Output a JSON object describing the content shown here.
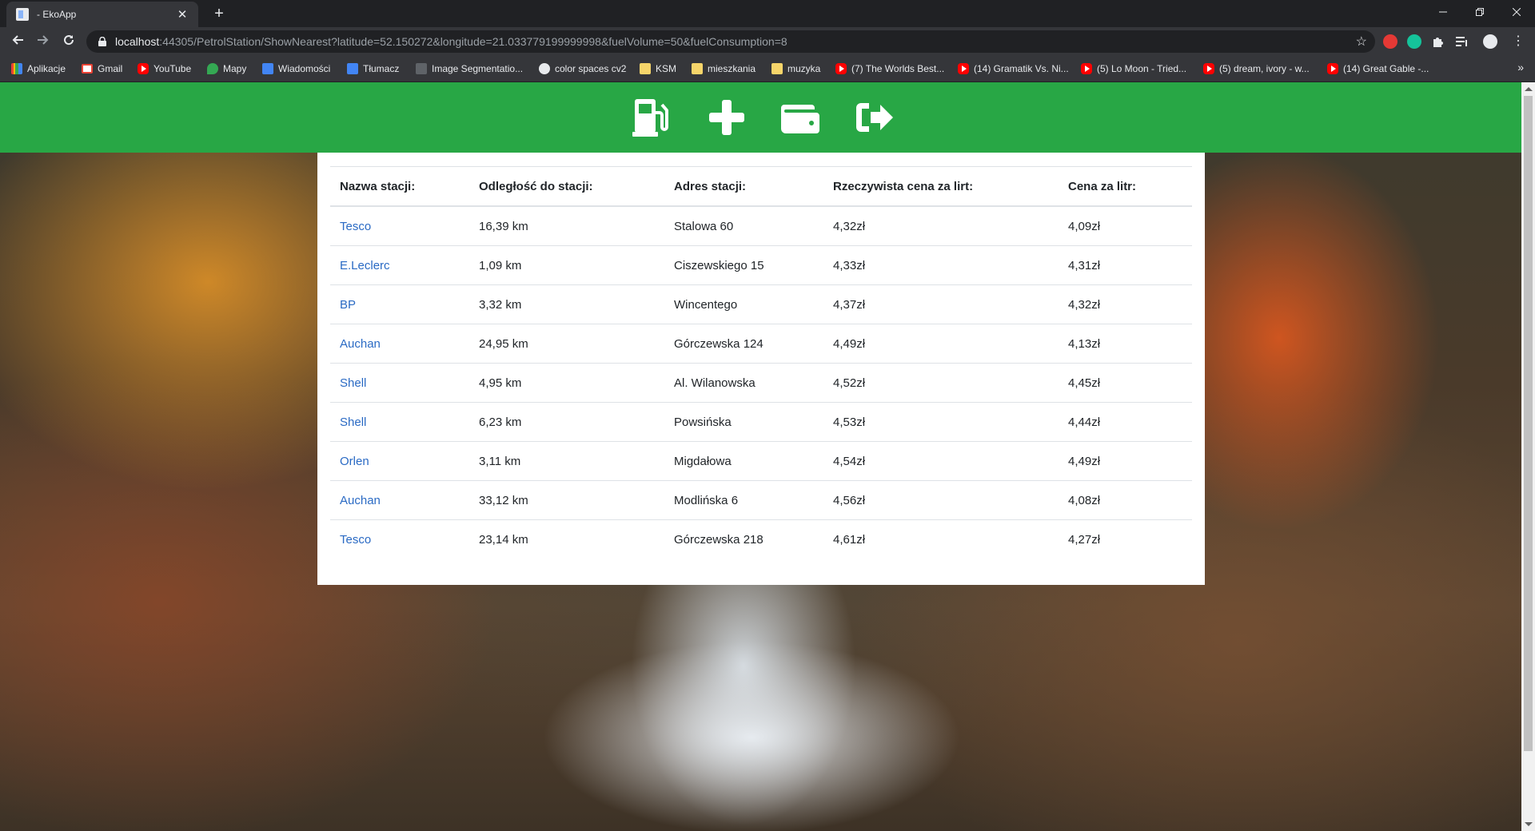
{
  "browser": {
    "tab_title": "- EkoApp",
    "tab_close": "✕",
    "new_tab": "+",
    "url_host": "localhost",
    "url_rest": ":44305/PetrolStation/ShowNearest?latitude=52.150272&longitude=21.033779199999998&fuelVolume=50&fuelConsumption=8",
    "bookmarks": [
      {
        "label": "Aplikacje",
        "icon": "apps-grid-icon"
      },
      {
        "label": "Gmail",
        "icon": "gmail-icon"
      },
      {
        "label": "YouTube",
        "icon": "youtube-icon"
      },
      {
        "label": "Mapy",
        "icon": "maps-icon"
      },
      {
        "label": "Wiadomości",
        "icon": "news-icon"
      },
      {
        "label": "Tłumacz",
        "icon": "translate-icon"
      },
      {
        "label": "Image Segmentatio...",
        "icon": "page-icon"
      },
      {
        "label": "color spaces cv2",
        "icon": "globe-icon"
      },
      {
        "label": "KSM",
        "icon": "folder-icon"
      },
      {
        "label": "mieszkania",
        "icon": "folder-icon"
      },
      {
        "label": "muzyka",
        "icon": "folder-icon"
      },
      {
        "label": "(7) The Worlds Best...",
        "icon": "youtube-icon"
      },
      {
        "label": "(14) Gramatik Vs. Ni...",
        "icon": "youtube-icon"
      },
      {
        "label": "(5) Lo Moon - Tried...",
        "icon": "youtube-icon"
      },
      {
        "label": "(5) dream, ivory - w...",
        "icon": "youtube-icon"
      },
      {
        "label": "(14) Great Gable -...",
        "icon": "youtube-icon"
      }
    ],
    "bookmarks_more": "»"
  },
  "header": {
    "icons": [
      "gas-pump-icon",
      "plus-icon",
      "wallet-icon",
      "sign-out-icon"
    ],
    "color": "#28a745"
  },
  "table": {
    "headers": [
      "Nazwa stacji:",
      "Odległość do stacji:",
      "Adres stacji:",
      "Rzeczywista cena za lirt:",
      "Cena za litr:"
    ],
    "rows": [
      [
        "Tesco",
        "16,39 km",
        "Stalowa 60",
        "4,32zł",
        "4,09zł"
      ],
      [
        "E.Leclerc",
        "1,09 km",
        "Ciszewskiego 15",
        "4,33zł",
        "4,31zł"
      ],
      [
        "BP",
        "3,32 km",
        "Wincentego",
        "4,37zł",
        "4,32zł"
      ],
      [
        "Auchan",
        "24,95 km",
        "Górczewska 124",
        "4,49zł",
        "4,13zł"
      ],
      [
        "Shell",
        "4,95 km",
        "Al. Wilanowska",
        "4,52zł",
        "4,45zł"
      ],
      [
        "Shell",
        "6,23 km",
        "Powsińska",
        "4,53zł",
        "4,44zł"
      ],
      [
        "Orlen",
        "3,11 km",
        "Migdałowa",
        "4,54zł",
        "4,49zł"
      ],
      [
        "Auchan",
        "33,12 km",
        "Modlińska 6",
        "4,56zł",
        "4,08zł"
      ],
      [
        "Tesco",
        "23,14 km",
        "Górczewska 218",
        "4,61zł",
        "4,27zł"
      ]
    ]
  }
}
